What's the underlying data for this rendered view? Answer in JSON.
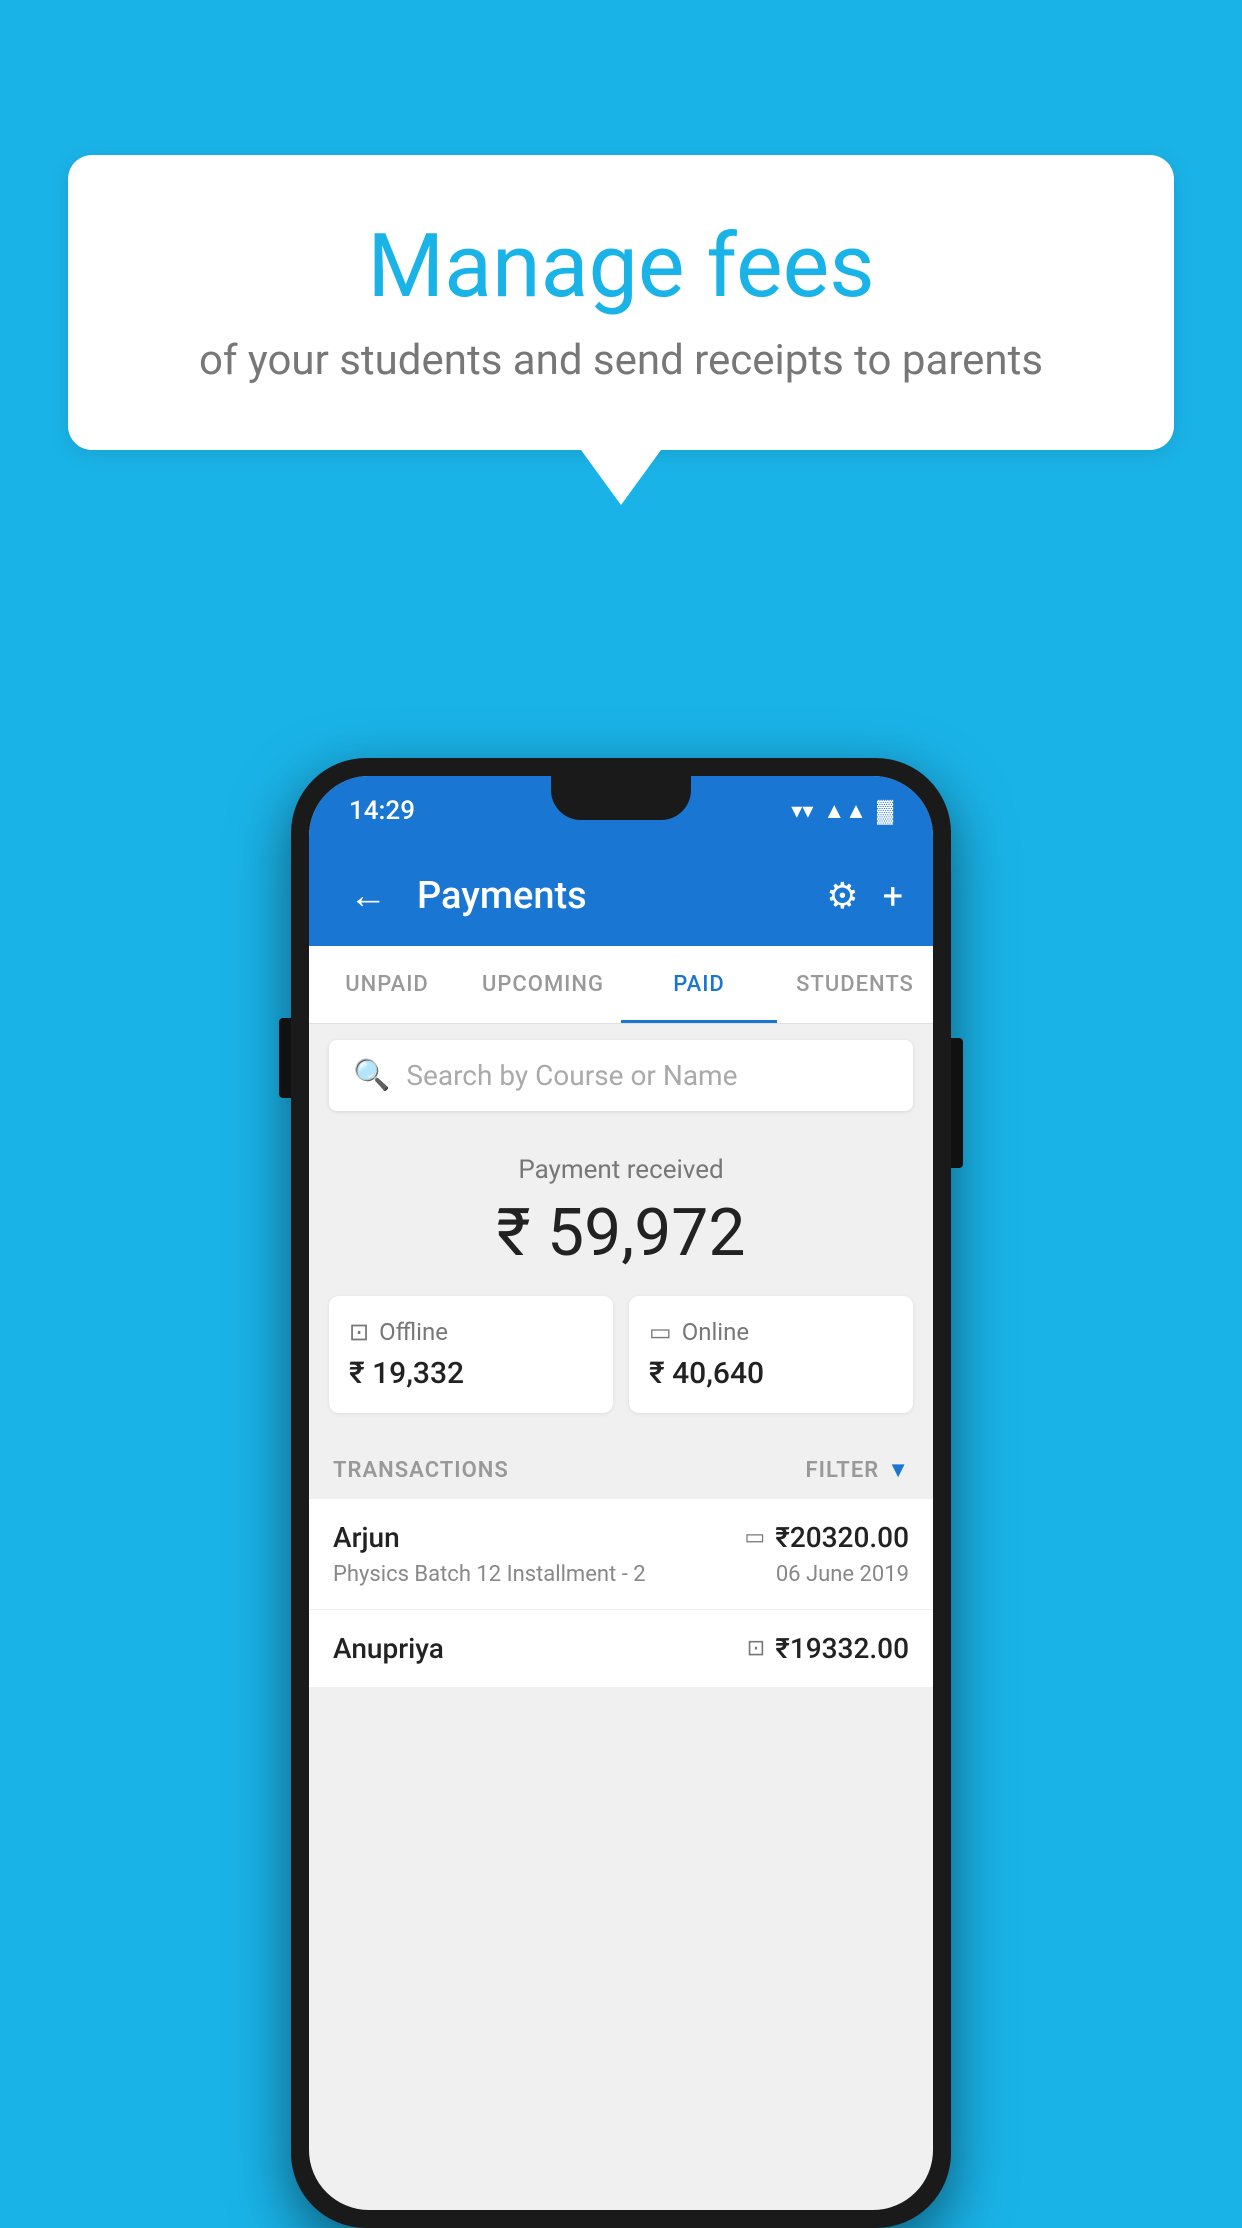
{
  "background_color": "#1ab3e8",
  "speech_bubble": {
    "title": "Manage fees",
    "subtitle": "of your students and send receipts to parents"
  },
  "status_bar": {
    "time": "14:29",
    "wifi": "▼",
    "signal": "▲",
    "battery": "▓"
  },
  "app_bar": {
    "back_label": "←",
    "title": "Payments",
    "gear_label": "⚙",
    "plus_label": "+"
  },
  "tabs": [
    {
      "id": "unpaid",
      "label": "UNPAID",
      "active": false
    },
    {
      "id": "upcoming",
      "label": "UPCOMING",
      "active": false
    },
    {
      "id": "paid",
      "label": "PAID",
      "active": true
    },
    {
      "id": "students",
      "label": "STUDENTS",
      "active": false
    }
  ],
  "search": {
    "placeholder": "Search by Course or Name"
  },
  "payment_received": {
    "label": "Payment received",
    "amount": "₹ 59,972",
    "offline": {
      "icon": "💳",
      "type": "Offline",
      "amount": "₹ 19,332"
    },
    "online": {
      "icon": "💳",
      "type": "Online",
      "amount": "₹ 40,640"
    }
  },
  "transactions": {
    "label": "TRANSACTIONS",
    "filter_label": "FILTER",
    "rows": [
      {
        "name": "Arjun",
        "icon": "card",
        "amount": "₹20320.00",
        "course": "Physics Batch 12 Installment - 2",
        "date": "06 June 2019"
      },
      {
        "name": "Anupriya",
        "icon": "rupee",
        "amount": "₹19332.00",
        "course": "",
        "date": ""
      }
    ]
  }
}
